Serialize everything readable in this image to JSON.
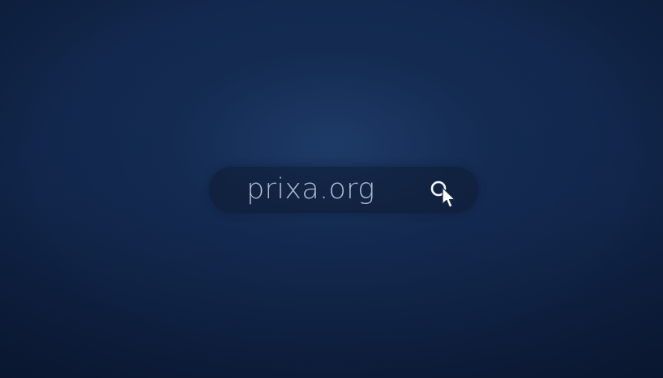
{
  "search": {
    "value": "prixa.org"
  },
  "icons": {
    "search": "search-icon",
    "cursor": "mouse-pointer-icon"
  },
  "colors": {
    "background": "#11264a",
    "text": "#aeb9cf",
    "icon": "#f2f5fa"
  }
}
